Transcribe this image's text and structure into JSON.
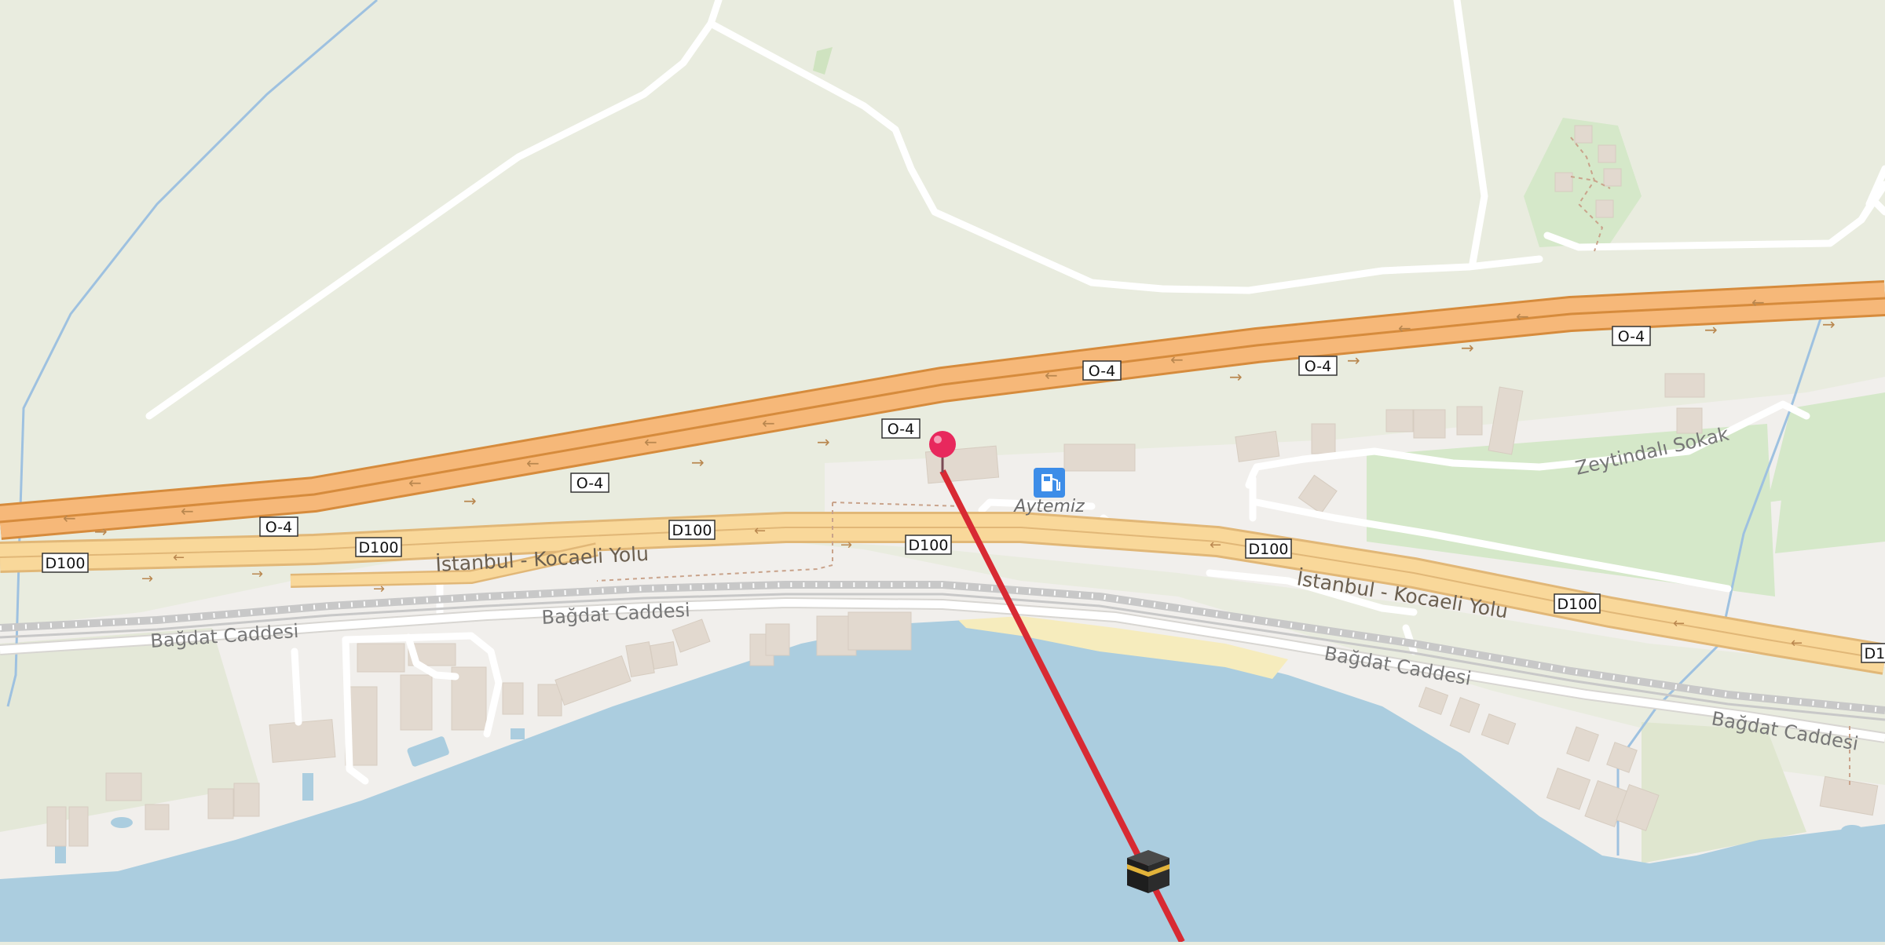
{
  "map": {
    "road_refs": {
      "motorway": "O-4",
      "trunk": "D100"
    },
    "street_names": {
      "highway": "İstanbul - Kocaeli Yolu",
      "coastal": "Bağdat Caddesi",
      "side_street": "Zeytindalı Sokak"
    },
    "poi": {
      "fuel_station": "Aytemiz",
      "fuel_icon": "fuel-pump-icon",
      "destination_icon": "kaaba-icon",
      "marker_icon": "location-pin-icon"
    },
    "colors": {
      "land": "#e9ecdf",
      "water": "#abcddf",
      "motorway": "#f6b879",
      "trunk": "#f9d89a",
      "built_area": "#f1efec",
      "park": "#d5e8c9",
      "sand": "#f6ecbd",
      "qibla_line": "#d82a33",
      "marker": "#e8285d"
    }
  }
}
